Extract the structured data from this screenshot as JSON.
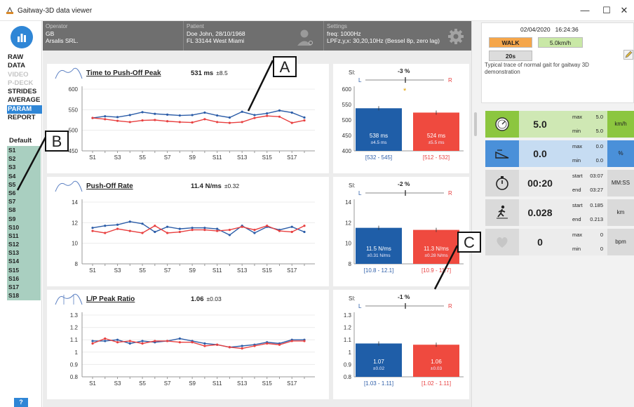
{
  "window": {
    "title": "Gaitway-3D data viewer",
    "minimize": "—",
    "maximize": "☐",
    "close": "✕"
  },
  "sidebar": {
    "nav": [
      {
        "label": "RAW",
        "state": "normal"
      },
      {
        "label": "DATA",
        "state": "normal"
      },
      {
        "label": "VIDEO",
        "state": "dim"
      },
      {
        "label": "P-DECK",
        "state": "dim"
      },
      {
        "label": "STRIDES",
        "state": "normal"
      },
      {
        "label": "AVERAGE",
        "state": "normal"
      },
      {
        "label": "PARAM",
        "state": "active"
      },
      {
        "label": "REPORT",
        "state": "normal"
      }
    ],
    "default_label": "Default",
    "strides": [
      "S1",
      "S2",
      "S3",
      "S4",
      "S5",
      "S6",
      "S7",
      "S8",
      "S9",
      "S10",
      "S11",
      "S12",
      "S13",
      "S14",
      "S15",
      "S16",
      "S17",
      "S18"
    ],
    "help": "?"
  },
  "header": {
    "operator": {
      "label": "Operator",
      "line1": "GB",
      "line2": "Arsalis SRL."
    },
    "patient": {
      "label": "Patient",
      "line1": "Doe John, 28/10/1968",
      "line2": "FL 33144 West Miami"
    },
    "settings": {
      "label": "Settings",
      "line1": "freq: 1000Hz",
      "line2": "LPFz,y,x: 30,20,10Hz (Bessel 8p, zero lag)"
    }
  },
  "info": {
    "date": "02/04/2020",
    "time": "16:24:36",
    "mode": "WALK",
    "speed": "5.0km/h",
    "duration": "20s",
    "description": "Typical trace of normal gait for gaitway 3D demonstration"
  },
  "stats": [
    {
      "icon": "speedometer-icon",
      "value": "5.0",
      "a_label": "max",
      "a_value": "5.0",
      "b_label": "min",
      "b_value": "5.0",
      "unit": "km/h",
      "icon_color": "#8cc63f",
      "value_color": "#cfe8b4",
      "unit_color": "#8cc63f"
    },
    {
      "icon": "incline-icon",
      "value": "0.0",
      "a_label": "max",
      "a_value": "0.0",
      "b_label": "min",
      "b_value": "0.0",
      "unit": "%",
      "icon_color": "#4a90d9",
      "value_color": "#c6dcf2",
      "unit_color": "#4a90d9"
    },
    {
      "icon": "stopwatch-icon",
      "value": "00:20",
      "a_label": "start",
      "a_value": "03:07",
      "b_label": "end",
      "b_value": "03:27",
      "unit": "MM:SS",
      "icon_color": "#dadada",
      "value_color": "#ececec",
      "unit_color": "#dadada"
    },
    {
      "icon": "walker-icon",
      "value": "0.028",
      "a_label": "start",
      "a_value": "0.185",
      "b_label": "end",
      "b_value": "0.213",
      "unit": "km",
      "icon_color": "#dadada",
      "value_color": "#ececec",
      "unit_color": "#dadada"
    },
    {
      "icon": "heart-icon",
      "value": "0",
      "a_label": "max",
      "a_value": "0",
      "b_label": "min",
      "b_value": "0",
      "unit": "bpm",
      "icon_color": "#dadada",
      "value_color": "#ececec",
      "unit_color": "#dadada"
    }
  ],
  "callouts": {
    "a": "A",
    "b": "B",
    "c": "C"
  },
  "panels": [
    {
      "title": "Time to Push-Off Peak",
      "value": "531 ms",
      "sd": "±8.5",
      "si_label": "SI:",
      "si_value": "-3 %",
      "si_star": "*",
      "L": "L",
      "R": "R",
      "left_bar_value": "538 ms",
      "left_bar_sd": "±4.5 ms",
      "right_bar_value": "524 ms",
      "right_bar_sd": "±5.5 ms",
      "left_range": "[532 - 545]",
      "right_range": "[512 - 532]"
    },
    {
      "title": "Push-Off Rate",
      "value": "11.4 N/ms",
      "sd": "±0.32",
      "si_label": "SI:",
      "si_value": "-2 %",
      "si_star": "",
      "L": "L",
      "R": "R",
      "left_bar_value": "11.5 N/ms",
      "left_bar_sd": "±0.31 N/ms",
      "right_bar_value": "11.3 N/ms",
      "right_bar_sd": "±0.28 N/ms",
      "left_range": "[10.8 - 12.1]",
      "right_range": "[10.9 - 11.7]"
    },
    {
      "title": "L/P Peak Ratio",
      "value": "1.06",
      "sd": "±0.03",
      "si_label": "SI:",
      "si_value": "-1 %",
      "si_star": "",
      "L": "L",
      "R": "R",
      "left_bar_value": "1.07",
      "left_bar_sd": "±0.02",
      "right_bar_value": "1.06",
      "right_bar_sd": "±0.03",
      "left_range": "[1.03 - 1.11]",
      "right_range": "[1.02 - 1.11]"
    }
  ],
  "chart_data": [
    {
      "type": "line",
      "title": "Time to Push-Off Peak",
      "x": [
        "S1",
        "S2",
        "S3",
        "S4",
        "S5",
        "S6",
        "S7",
        "S8",
        "S9",
        "S10",
        "S11",
        "S12",
        "S13",
        "S14",
        "S15",
        "S16",
        "S17",
        "S18"
      ],
      "x_tick_labels": [
        "S1",
        "S3",
        "S5",
        "S7",
        "S9",
        "S11",
        "S13",
        "S15",
        "S17"
      ],
      "ylim": [
        450,
        600
      ],
      "yticks": [
        "600",
        "550",
        "500",
        "450"
      ],
      "series": [
        {
          "color": "#2c5da8",
          "values": [
            530,
            534,
            532,
            537,
            544,
            540,
            538,
            536,
            537,
            543,
            536,
            531,
            545,
            537,
            541,
            548,
            543,
            531
          ]
        },
        {
          "color": "#e84040",
          "values": [
            530,
            527,
            523,
            520,
            524,
            525,
            522,
            520,
            519,
            527,
            520,
            518,
            520,
            530,
            535,
            533,
            518,
            524
          ]
        }
      ]
    },
    {
      "type": "bar",
      "categories": [
        "L",
        "R"
      ],
      "values": [
        538,
        524
      ],
      "ylim": [
        400,
        600
      ],
      "yticks": [
        "600",
        "550",
        "500",
        "450",
        "400"
      ],
      "colors": [
        "#1f5ea8",
        "#ef4a3f"
      ]
    },
    {
      "type": "line",
      "title": "Push-Off Rate",
      "x": [
        "S1",
        "S2",
        "S3",
        "S4",
        "S5",
        "S6",
        "S7",
        "S8",
        "S9",
        "S10",
        "S11",
        "S12",
        "S13",
        "S14",
        "S15",
        "S16",
        "S17",
        "S18"
      ],
      "x_tick_labels": [
        "S1",
        "S3",
        "S5",
        "S7",
        "S9",
        "S11",
        "S13",
        "S15",
        "S17"
      ],
      "ylim": [
        8,
        14
      ],
      "yticks": [
        "14",
        "12",
        "10",
        "8"
      ],
      "series": [
        {
          "color": "#2c5da8",
          "values": [
            11.5,
            11.7,
            11.8,
            12.1,
            11.9,
            11.1,
            11.6,
            11.4,
            11.5,
            11.5,
            11.4,
            10.8,
            11.7,
            11.0,
            11.6,
            11.3,
            11.6,
            11.1
          ]
        },
        {
          "color": "#e84040",
          "values": [
            11.2,
            11.0,
            11.4,
            11.2,
            11.0,
            11.7,
            11.0,
            11.1,
            11.3,
            11.3,
            11.2,
            11.3,
            11.6,
            11.3,
            11.7,
            11.2,
            11.1,
            11.7
          ]
        }
      ]
    },
    {
      "type": "bar",
      "categories": [
        "L",
        "R"
      ],
      "values": [
        11.5,
        11.3
      ],
      "ylim": [
        8,
        14
      ],
      "yticks": [
        "14",
        "12",
        "10",
        "8"
      ],
      "colors": [
        "#1f5ea8",
        "#ef4a3f"
      ]
    },
    {
      "type": "line",
      "title": "L/P Peak Ratio",
      "x": [
        "S1",
        "S2",
        "S3",
        "S4",
        "S5",
        "S6",
        "S7",
        "S8",
        "S9",
        "S10",
        "S11",
        "S12",
        "S13",
        "S14",
        "S15",
        "S16",
        "S17",
        "S18"
      ],
      "x_tick_labels": [
        "S1",
        "S3",
        "S5",
        "S7",
        "S9",
        "S11",
        "S13",
        "S15",
        "S17"
      ],
      "ylim": [
        0.8,
        1.3
      ],
      "yticks": [
        "1.3",
        "1.2",
        "1.1",
        "1",
        "0.9",
        "0.8"
      ],
      "series": [
        {
          "color": "#2c5da8",
          "values": [
            1.09,
            1.09,
            1.1,
            1.07,
            1.09,
            1.08,
            1.09,
            1.11,
            1.09,
            1.07,
            1.06,
            1.04,
            1.05,
            1.06,
            1.08,
            1.07,
            1.1,
            1.1
          ]
        },
        {
          "color": "#e84040",
          "values": [
            1.07,
            1.11,
            1.08,
            1.09,
            1.07,
            1.09,
            1.09,
            1.08,
            1.08,
            1.05,
            1.06,
            1.04,
            1.03,
            1.05,
            1.07,
            1.06,
            1.09,
            1.09
          ]
        }
      ]
    },
    {
      "type": "bar",
      "categories": [
        "L",
        "R"
      ],
      "values": [
        1.07,
        1.06
      ],
      "ylim": [
        0.8,
        1.3
      ],
      "yticks": [
        "1.3",
        "1.2",
        "1.1",
        "1",
        "0.9",
        "0.8"
      ],
      "colors": [
        "#1f5ea8",
        "#ef4a3f"
      ]
    }
  ]
}
